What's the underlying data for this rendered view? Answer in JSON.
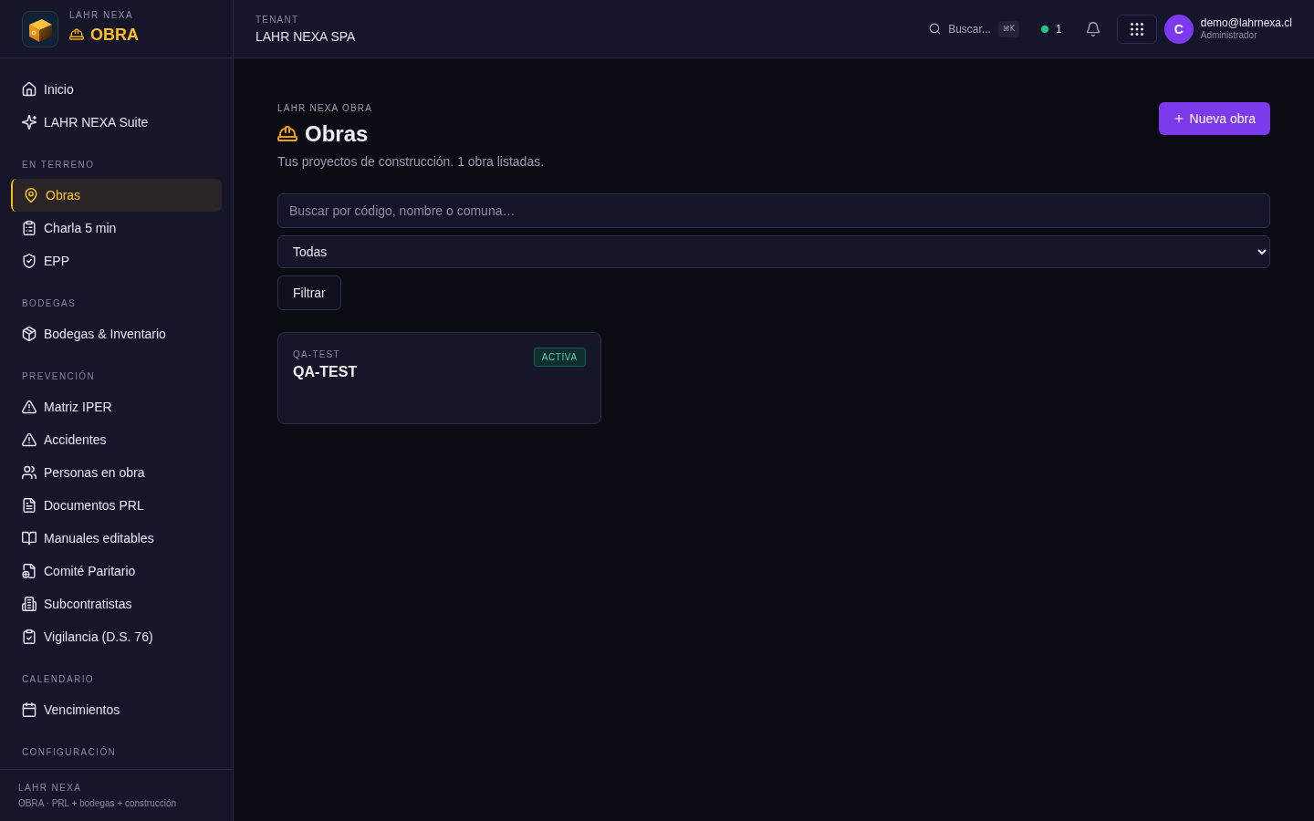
{
  "brand": {
    "eyebrow": "LAHR NEXA",
    "product": "OBRA"
  },
  "sidebar": {
    "sections": [
      {
        "items": [
          {
            "label": "Inicio",
            "selected": false
          },
          {
            "label": "LAHR NEXA Suite",
            "selected": false
          }
        ]
      },
      {
        "title": "EN TERRENO",
        "items": [
          {
            "label": "Obras",
            "selected": true
          },
          {
            "label": "Charla 5 min",
            "selected": false
          },
          {
            "label": "EPP",
            "selected": false
          }
        ]
      },
      {
        "title": "BODEGAS",
        "items": [
          {
            "label": "Bodegas & Inventario",
            "selected": false
          }
        ]
      },
      {
        "title": "PREVENCIÓN",
        "items": [
          {
            "label": "Matriz IPER",
            "selected": false
          },
          {
            "label": "Accidentes",
            "selected": false
          },
          {
            "label": "Personas en obra",
            "selected": false
          },
          {
            "label": "Documentos PRL",
            "selected": false
          },
          {
            "label": "Manuales editables",
            "selected": false
          },
          {
            "label": "Comité Paritario",
            "selected": false
          },
          {
            "label": "Subcontratistas",
            "selected": false
          },
          {
            "label": "Vigilancia (D.S. 76)",
            "selected": false
          }
        ]
      },
      {
        "title": "CALENDARIO",
        "items": [
          {
            "label": "Vencimientos",
            "selected": false
          }
        ]
      },
      {
        "title": "CONFIGURACIÓN"
      }
    ],
    "footer": {
      "title": "LAHR NEXA",
      "subtitle": "OBRA · PRL + bodegas + construcción"
    }
  },
  "topbar": {
    "tenant_label": "TENANT",
    "tenant": "LAHR NEXA SPA",
    "search": {
      "label": "Buscar...",
      "shortcut": "⌘K"
    },
    "online_count": "1",
    "user": {
      "initial": "C",
      "email": "demo@lahrnexa.cl",
      "role": "Administrador"
    }
  },
  "page": {
    "eyebrow": "LAHR NEXA OBRA",
    "title": "Obras",
    "subtitle": "Tus proyectos de construcción. 1 obra listadas.",
    "new_button": "Nueva obra",
    "search": {
      "placeholder": "Buscar por código, nombre o comuna…"
    },
    "status_filter": {
      "value": "Todas"
    },
    "filter_button": "Filtrar",
    "cards": [
      {
        "code": "QA-TEST",
        "name": "QA-TEST",
        "status": "ACTIVA"
      }
    ]
  }
}
